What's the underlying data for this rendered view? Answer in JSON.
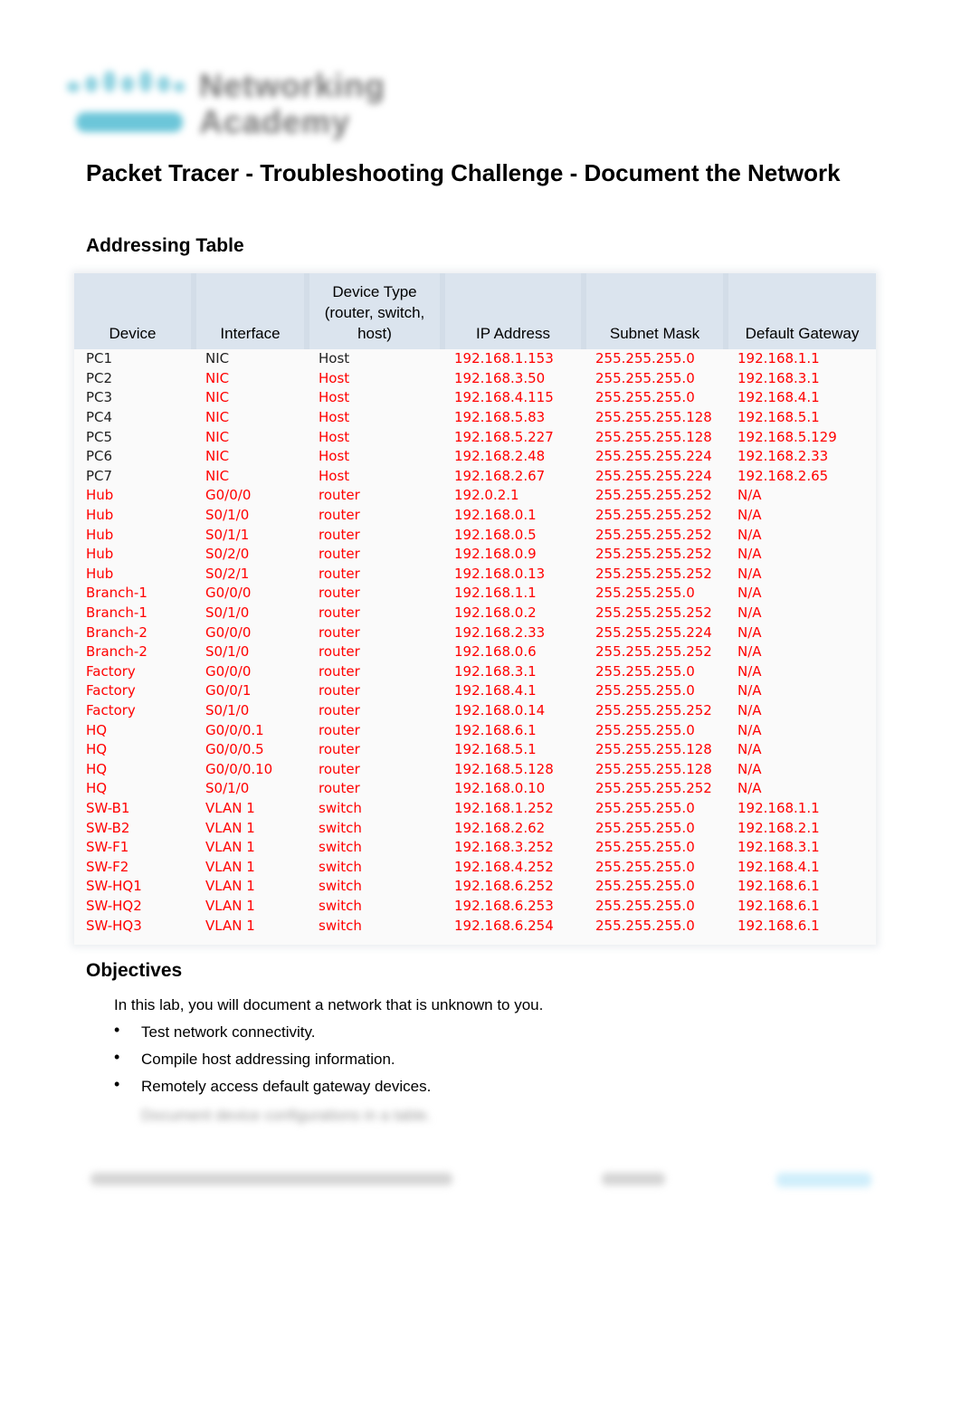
{
  "logo": {
    "line1": "Networking",
    "line2": "Academy",
    "brand": "cisco"
  },
  "title": "Packet Tracer - Troubleshooting Challenge - Document the Network",
  "addressing_table": {
    "heading": "Addressing Table",
    "columns": [
      "Device",
      "Interface",
      "Device Type (router, switch, host)",
      "IP Address",
      "Subnet Mask",
      "Default Gateway"
    ],
    "rows": [
      [
        "PC1",
        "NIC",
        "Host",
        "192.168.1.153",
        "255.255.255.0",
        "192.168.1.1"
      ],
      [
        "PC2",
        "NIC",
        "Host",
        "192.168.3.50",
        "255.255.255.0",
        "192.168.3.1"
      ],
      [
        "PC3",
        "NIC",
        "Host",
        "192.168.4.115",
        "255.255.255.0",
        "192.168.4.1"
      ],
      [
        "PC4",
        "NIC",
        "Host",
        "192.168.5.83",
        "255.255.255.128",
        "192.168.5.1"
      ],
      [
        "PC5",
        "NIC",
        "Host",
        "192.168.5.227",
        "255.255.255.128",
        "192.168.5.129"
      ],
      [
        "PC6",
        "NIC",
        "Host",
        "192.168.2.48",
        "255.255.255.224",
        "192.168.2.33"
      ],
      [
        "PC7",
        "NIC",
        "Host",
        "192.168.2.67",
        "255.255.255.224",
        "192.168.2.65"
      ],
      [
        "Hub",
        "G0/0/0",
        "router",
        "192.0.2.1",
        "255.255.255.252",
        "N/A"
      ],
      [
        "Hub",
        "S0/1/0",
        "router",
        "192.168.0.1",
        "255.255.255.252",
        "N/A"
      ],
      [
        "Hub",
        "S0/1/1",
        "router",
        "192.168.0.5",
        "255.255.255.252",
        "N/A"
      ],
      [
        "Hub",
        "S0/2/0",
        "router",
        "192.168.0.9",
        "255.255.255.252",
        "N/A"
      ],
      [
        "Hub",
        "S0/2/1",
        "router",
        "192.168.0.13",
        "255.255.255.252",
        "N/A"
      ],
      [
        "Branch-1",
        "G0/0/0",
        "router",
        "192.168.1.1",
        "255.255.255.0",
        "N/A"
      ],
      [
        "Branch-1",
        "S0/1/0",
        "router",
        "192.168.0.2",
        "255.255.255.252",
        "N/A"
      ],
      [
        "Branch-2",
        "G0/0/0",
        "router",
        "192.168.2.33",
        "255.255.255.224",
        "N/A"
      ],
      [
        "Branch-2",
        "S0/1/0",
        "router",
        "192.168.0.6",
        "255.255.255.252",
        "N/A"
      ],
      [
        "Factory",
        "G0/0/0",
        "router",
        "192.168.3.1",
        "255.255.255.0",
        "N/A"
      ],
      [
        "Factory",
        "G0/0/1",
        "router",
        "192.168.4.1",
        "255.255.255.0",
        "N/A"
      ],
      [
        "Factory",
        "S0/1/0",
        "router",
        "192.168.0.14",
        "255.255.255.252",
        "N/A"
      ],
      [
        "HQ",
        "G0/0/0.1",
        "router",
        "192.168.6.1",
        "255.255.255.0",
        "N/A"
      ],
      [
        "HQ",
        "G0/0/0.5",
        "router",
        "192.168.5.1",
        "255.255.255.128",
        "N/A"
      ],
      [
        "HQ",
        "G0/0/0.10",
        "router",
        "192.168.5.128",
        "255.255.255.128",
        "N/A"
      ],
      [
        "HQ",
        "S0/1/0",
        "router",
        "192.168.0.10",
        "255.255.255.252",
        "N/A"
      ],
      [
        "SW-B1",
        "VLAN 1",
        "switch",
        "192.168.1.252",
        "255.255.255.0",
        "192.168.1.1"
      ],
      [
        "SW-B2",
        "VLAN 1",
        "switch",
        "192.168.2.62",
        "255.255.255.0",
        "192.168.2.1"
      ],
      [
        "SW-F1",
        "VLAN 1",
        "switch",
        "192.168.3.252",
        "255.255.255.0",
        "192.168.3.1"
      ],
      [
        "SW-F2",
        "VLAN 1",
        "switch",
        "192.168.4.252",
        "255.255.255.0",
        "192.168.4.1"
      ],
      [
        "SW-HQ1",
        "VLAN 1",
        "switch",
        "192.168.6.252",
        "255.255.255.0",
        "192.168.6.1"
      ],
      [
        "SW-HQ2",
        "VLAN 1",
        "switch",
        "192.168.6.253",
        "255.255.255.0",
        "192.168.6.1"
      ],
      [
        "SW-HQ3",
        "VLAN 1",
        "switch",
        "192.168.6.254",
        "255.255.255.0",
        "192.168.6.1"
      ]
    ],
    "black_cells": [
      [
        0,
        0
      ],
      [
        0,
        1
      ],
      [
        0,
        2
      ],
      [
        1,
        0
      ],
      [
        2,
        0
      ],
      [
        3,
        0
      ],
      [
        4,
        0
      ],
      [
        5,
        0
      ],
      [
        6,
        0
      ]
    ],
    "answer_color": "#ff0000",
    "header_bg": "#dbe4ee"
  },
  "objectives": {
    "heading": "Objectives",
    "intro": "In this lab, you will document a network that is unknown to you.",
    "items": [
      "Test network connectivity.",
      "Compile host addressing information.",
      "Remotely access default gateway devices."
    ],
    "blurred_item": "Document device configurations in a table."
  }
}
